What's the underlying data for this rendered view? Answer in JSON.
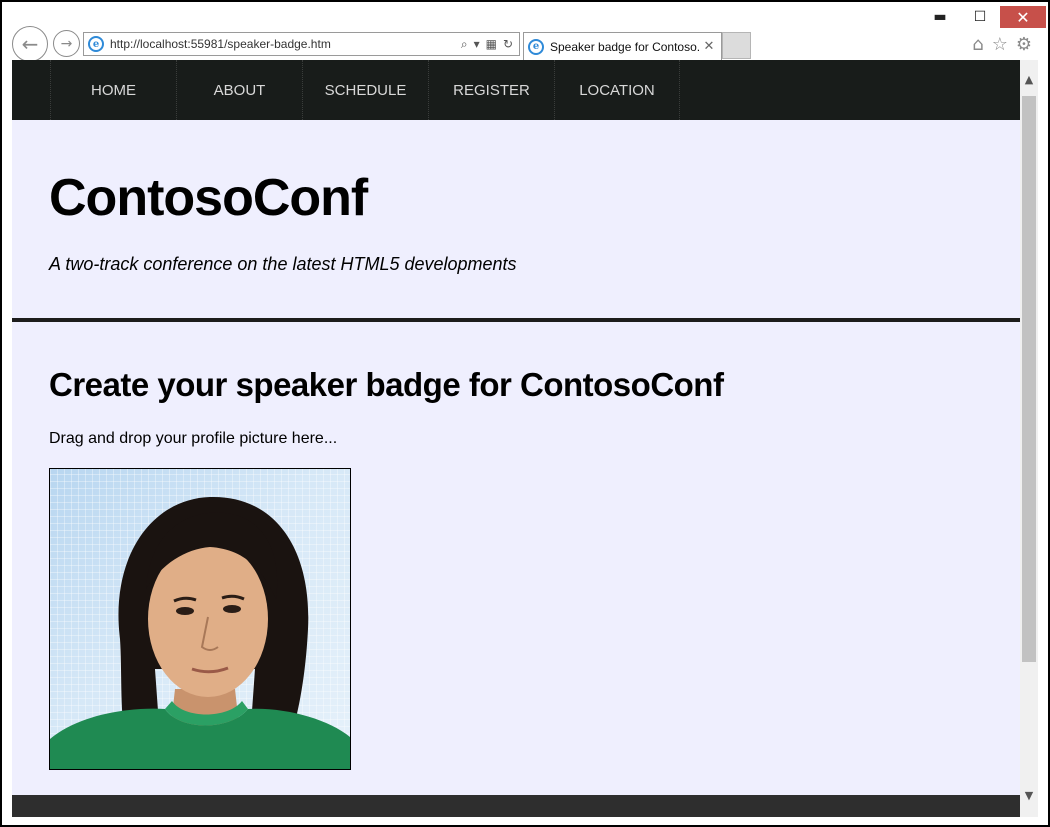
{
  "window": {
    "minimize_glyph": "▬",
    "maximize_glyph": "☐",
    "close_glyph": "✕",
    "close_color": "#c7504a"
  },
  "browser": {
    "back_glyph": "←",
    "forward_glyph": "→",
    "url": "http://localhost:55981/speaker-badge.htm",
    "address_tools": [
      "search-icon",
      "dropdown-icon",
      "compat-view-icon",
      "refresh-icon"
    ],
    "tab_title": "Speaker badge for Contoso...",
    "tab_close_glyph": "✕",
    "right_tools": [
      "home-icon",
      "favorites-star-icon",
      "settings-gear-icon"
    ]
  },
  "nav": {
    "items": [
      "HOME",
      "ABOUT",
      "SCHEDULE",
      "REGISTER",
      "LOCATION"
    ]
  },
  "header": {
    "title": "ContosoConf",
    "tagline": "A two-track conference on the latest HTML5 developments"
  },
  "main": {
    "heading": "Create your speaker badge for ContosoConf",
    "instruction": "Drag and drop your profile picture here...",
    "profile_picture": "profile-photo"
  },
  "colors": {
    "page_background": "#efeffe",
    "nav_background": "#181c1a",
    "nav_text": "#d8d8d8",
    "footer_background": "#2e2e2e"
  }
}
